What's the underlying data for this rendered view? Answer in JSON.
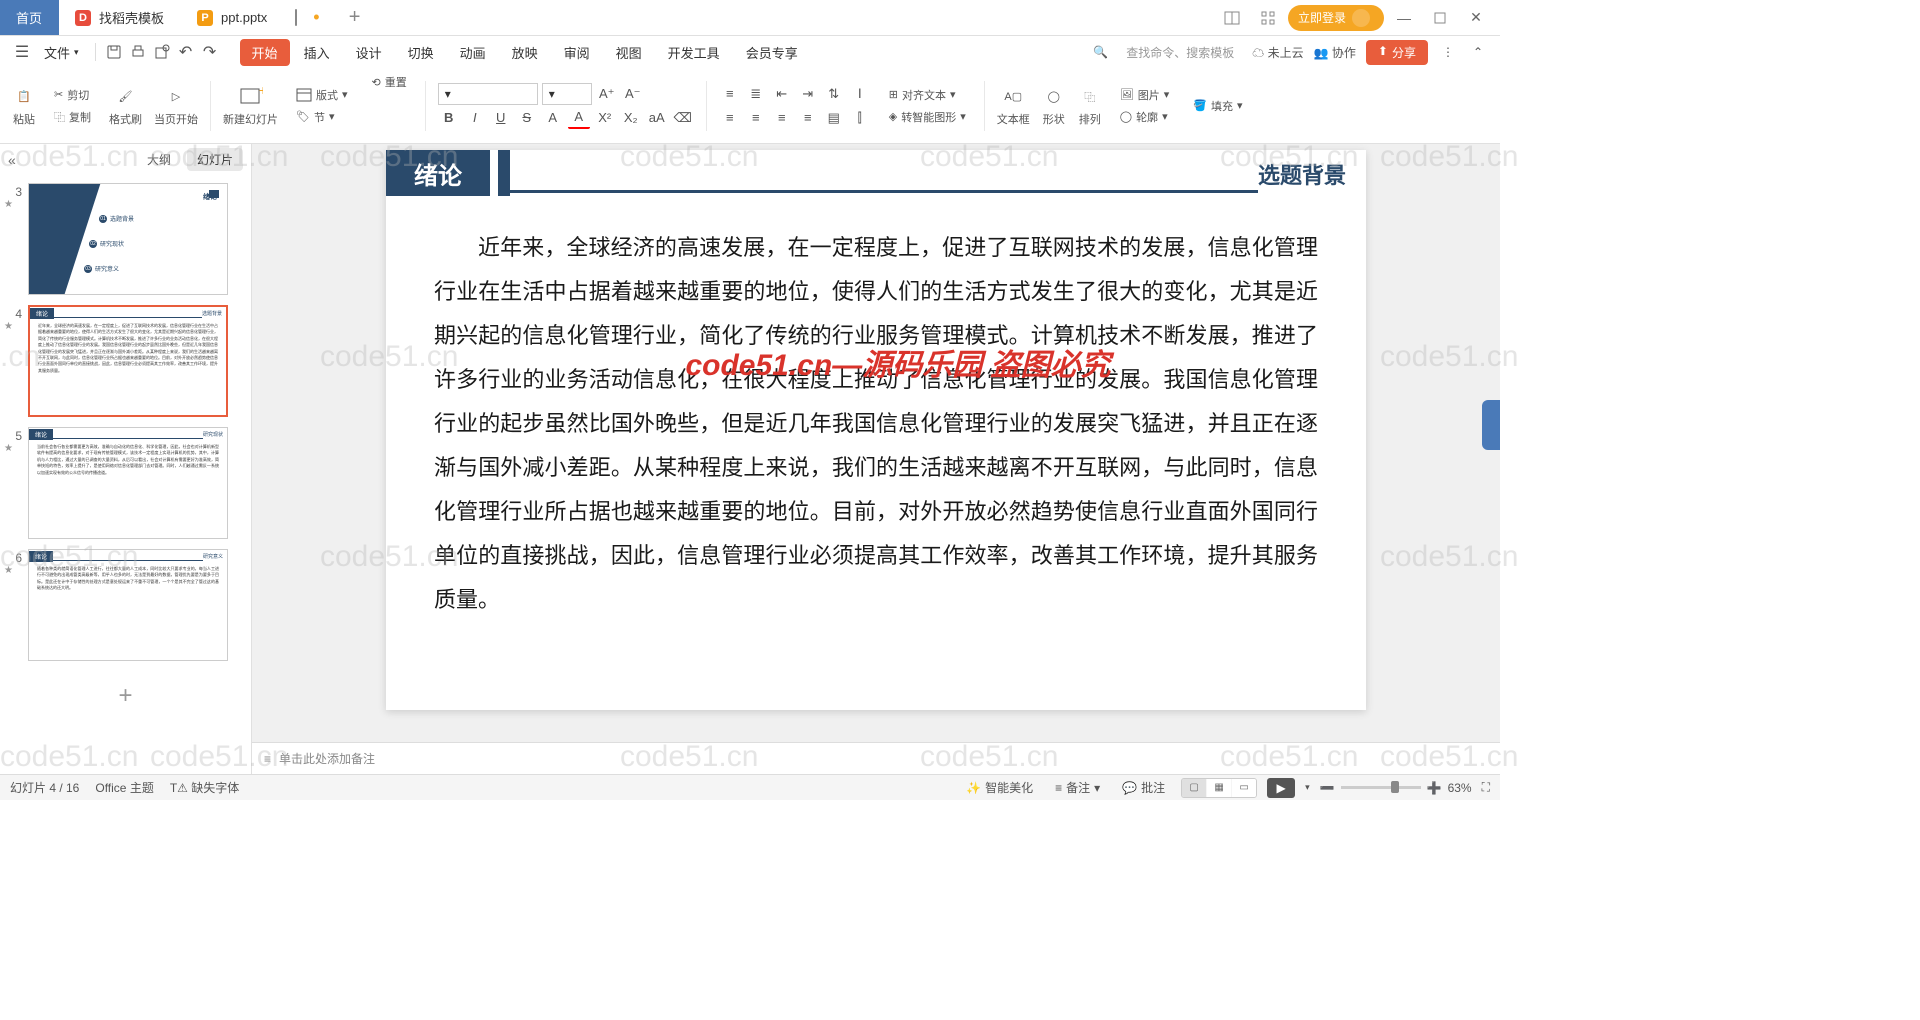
{
  "titlebar": {
    "home": "首页",
    "tab_template": "找稻壳模板",
    "tab_file": "ppt.pptx",
    "login": "立即登录"
  },
  "menubar": {
    "file": "文件",
    "tabs": [
      "开始",
      "插入",
      "设计",
      "切换",
      "动画",
      "放映",
      "审阅",
      "视图",
      "开发工具",
      "会员专享"
    ],
    "active_tab": 0,
    "search_placeholder": "查找命令、搜索模板",
    "cloud": "未上云",
    "collab": "协作",
    "share": "分享"
  },
  "ribbon": {
    "paste": "粘贴",
    "cut": "剪切",
    "copy": "复制",
    "fmtpaint": "格式刷",
    "curpage": "当页开始",
    "newslide": "新建幻灯片",
    "layout": "版式",
    "section": "节",
    "reset": "重置",
    "aligntext": "对齐文本",
    "smartart": "转智能图形",
    "textbox": "文本框",
    "shape": "形状",
    "arrange": "排列",
    "picture": "图片",
    "fill": "填充",
    "outline": "轮廓"
  },
  "sidepanel": {
    "outline": "大纲",
    "slides": "幻灯片",
    "thumb3": {
      "title": "绪论",
      "i1": "选题背景",
      "i2": "研究现状",
      "i3": "研究意义"
    },
    "nums": [
      "3",
      "4",
      "5",
      "6"
    ]
  },
  "slide": {
    "title": "绪论",
    "subtitle": "选题背景",
    "body": "近年来，全球经济的高速发展，在一定程度上，促进了互联网技术的发展，信息化管理行业在生活中占据着越来越重要的地位，使得人们的生活方式发生了很大的变化，尤其是近期兴起的信息化管理行业，简化了传统的行业服务管理模式。计算机技术不断发展，推进了许多行业的业务活动信息化，在很大程度上推动了信息化管理行业的发展。我国信息化管理行业的起步虽然比国外晚些，但是近几年我国信息化管理行业的发展突飞猛进，并且正在逐渐与国外减小差距。从某种程度上来说，我们的生活越来越离不开互联网，与此同时，信息化管理行业所占据也越来越重要的地位。目前，对外开放必然趋势使信息行业直面外国同行单位的直接挑战，因此，信息管理行业必须提高其工作效率，改善其工作环境，提升其服务质量。",
    "watermark": "code51.cn—源码乐园 盗图必究"
  },
  "notes": "单击此处添加备注",
  "statusbar": {
    "slide_pos": "幻灯片 4 / 16",
    "theme": "Office 主题",
    "fonts": "缺失字体",
    "beautify": "智能美化",
    "notes_btn": "备注",
    "comments": "批注",
    "zoom": "63%"
  },
  "watermark_text": "code51.cn"
}
